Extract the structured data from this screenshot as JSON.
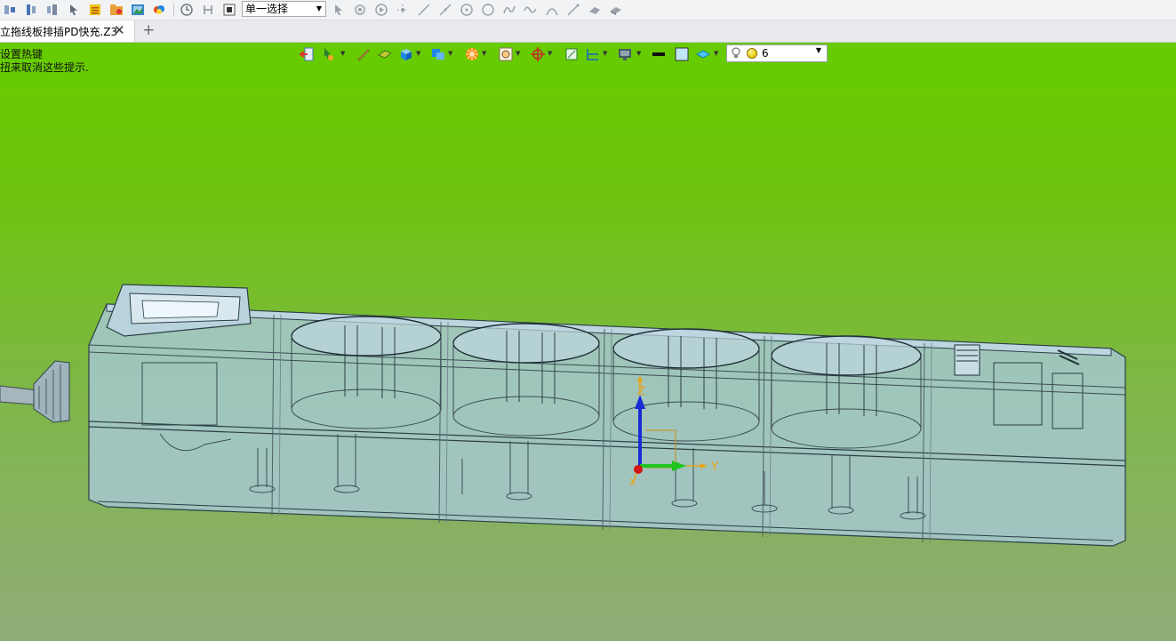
{
  "toolbar": {
    "selection_mode": "单一选择",
    "icons": [
      "insert-left-icon",
      "insert-middle-icon",
      "insert-right-icon",
      "pointer-icon",
      "list-icon",
      "folder-icon",
      "image-icon",
      "gallery-icon",
      "history-icon",
      "step-icon",
      "stop-icon",
      "filter-pick-icon",
      "filter-face-icon",
      "play-icon",
      "point-icon",
      "line-icon",
      "line-2-icon",
      "circle-point-icon",
      "circle-icon",
      "curve-icon",
      "wave-icon",
      "arc-icon",
      "edge-icon",
      "hand-icon",
      "part-icon"
    ]
  },
  "tabs": {
    "active_title": "立拖线板排插PD快充.Z3",
    "add_label": "+"
  },
  "viewport": {
    "hint_line1": "设置热键",
    "hint_line2": "扭来取消这些提示.",
    "light_value": "6",
    "axis_labels": {
      "z": "Z",
      "y": "Y",
      "x": "X"
    }
  },
  "colors": {
    "viewport_top": "#66cc00",
    "viewport_bottom": "#8fac78",
    "model_body": "#a7c8d4",
    "axis_z": "#1a2bd6",
    "axis_y": "#1fc41f",
    "axis_x": "#d11414"
  }
}
